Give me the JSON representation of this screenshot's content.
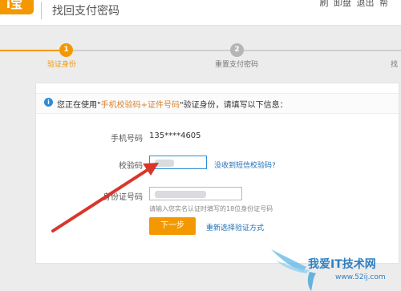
{
  "header": {
    "logo_text": "i宝",
    "title": "找回支付密码",
    "links": [
      "刷",
      "卸盘",
      "退出",
      "帮"
    ]
  },
  "steps": [
    {
      "number": "1",
      "label": "验证身份",
      "active": true
    },
    {
      "number": "2",
      "label": "重置支付密码",
      "active": false
    },
    {
      "number": "",
      "label": "找",
      "active": false
    }
  ],
  "notice": {
    "icon": "i",
    "prefix": "您正在使用\"",
    "highlight": "手机校验码+证件号码",
    "suffix": "\"验证身份，请填写以下信息："
  },
  "form": {
    "phone_label": "手机号码",
    "phone_value": "135****4605",
    "code_label": "校验码",
    "code_link": "没收到短信校验码?",
    "id_label": "身份证号码",
    "id_hint": "请输入您实名认证时填写的18位身份证号码",
    "next_button": "下一步",
    "reselect_link": "重新选择验证方式"
  },
  "watermark": {
    "text": "我爱IT技术网",
    "url": "www.52ij.com"
  },
  "colors": {
    "accent": "#f39800",
    "link": "#1f6fb5",
    "annotation_arrow": "#d9362b"
  }
}
